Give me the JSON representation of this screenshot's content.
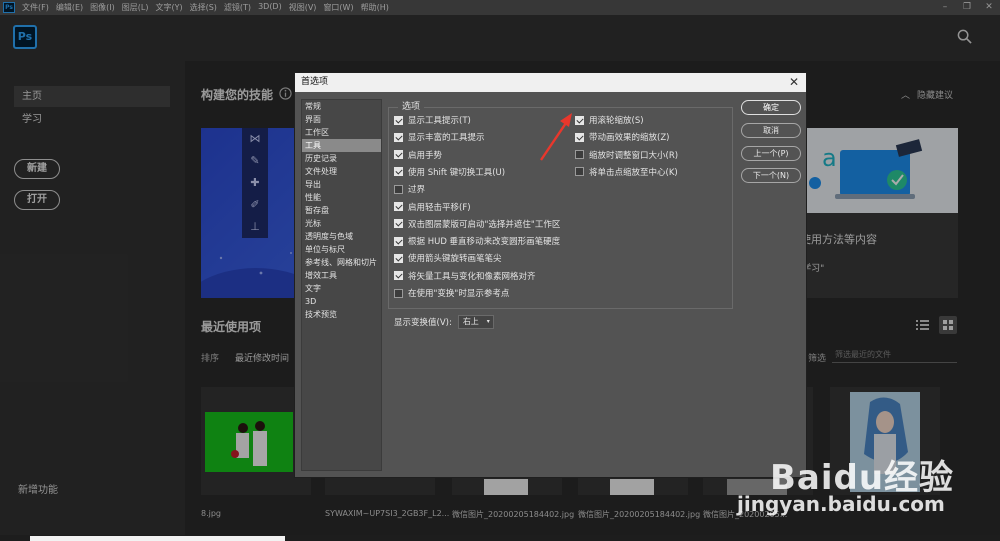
{
  "menubar": {
    "items": [
      "文件(F)",
      "编辑(E)",
      "图像(I)",
      "图层(L)",
      "文字(Y)",
      "选择(S)",
      "滤镜(T)",
      "3D(D)",
      "视图(V)",
      "窗口(W)",
      "帮助(H)"
    ],
    "window_controls": [
      "–",
      "❐",
      "✕"
    ]
  },
  "app": {
    "logo": "Ps",
    "mini_logo": "Ps"
  },
  "sidebar": {
    "home": "主页",
    "learn": "学习",
    "new_button": "新建",
    "open_button": "打开",
    "whats_new": "新增功能"
  },
  "home": {
    "skills_title": "构建您的技能",
    "hide_suggestions": "隐藏建议",
    "card2_line1": "戈使用方法等内容",
    "card2_line2": "的\"学习\"",
    "recent_title": "最近使用项",
    "sort_label": "排序",
    "sort_value": "最近修改时间",
    "filter_label": "筛选",
    "filter_placeholder": "筛选最近的文件",
    "files": [
      "8.jpg",
      "SYWAXIM~UP7SI3_2GB3F_L2...",
      "微信图片_20200205184402.jpg",
      "微信图片_20200205184402.jpg",
      "微信图片_20200205..."
    ]
  },
  "dialog": {
    "title": "首选项",
    "close": "✕",
    "categories": [
      "常规",
      "界面",
      "工作区",
      "工具",
      "历史记录",
      "文件处理",
      "导出",
      "性能",
      "暂存盘",
      "光标",
      "透明度与色域",
      "单位与标尺",
      "参考线、网格和切片",
      "增效工具",
      "文字",
      "3D",
      "技术预览"
    ],
    "selected_category": "工具",
    "options_legend": "选项",
    "left_options": [
      {
        "label": "显示工具提示(T)",
        "checked": true
      },
      {
        "label": "显示丰富的工具提示",
        "checked": true
      },
      {
        "label": "启用手势",
        "checked": true
      },
      {
        "label": "使用 Shift 键切换工具(U)",
        "checked": true
      },
      {
        "label": "过界",
        "checked": false
      },
      {
        "label": "启用轻击平移(F)",
        "checked": true
      },
      {
        "label": "双击图层蒙版可启动\"选择并遮住\"工作区",
        "checked": true
      },
      {
        "label": "根据 HUD 垂直移动来改变圆形画笔硬度",
        "checked": true
      },
      {
        "label": "使用箭头键旋转画笔笔尖",
        "checked": true
      },
      {
        "label": "将矢量工具与变化和像素网格对齐",
        "checked": true
      },
      {
        "label": "在使用\"变换\"时显示参考点",
        "checked": false
      }
    ],
    "right_options": [
      {
        "label": "用滚轮缩放(S)",
        "checked": true
      },
      {
        "label": "带动画效果的缩放(Z)",
        "checked": true
      },
      {
        "label": "缩放时调整窗口大小(R)",
        "checked": false
      },
      {
        "label": "将单击点缩放至中心(K)",
        "checked": false
      }
    ],
    "transform_label": "显示变换值(V):",
    "transform_value": "右上",
    "buttons": {
      "ok": "确定",
      "cancel": "取消",
      "prev": "上一个(P)",
      "next": "下一个(N)"
    }
  },
  "watermark": {
    "brand": "Baidu经验",
    "url": "jingyan.baidu.com"
  },
  "colors": {
    "accent": "#31a8ff",
    "arrow": "#e8372c"
  }
}
